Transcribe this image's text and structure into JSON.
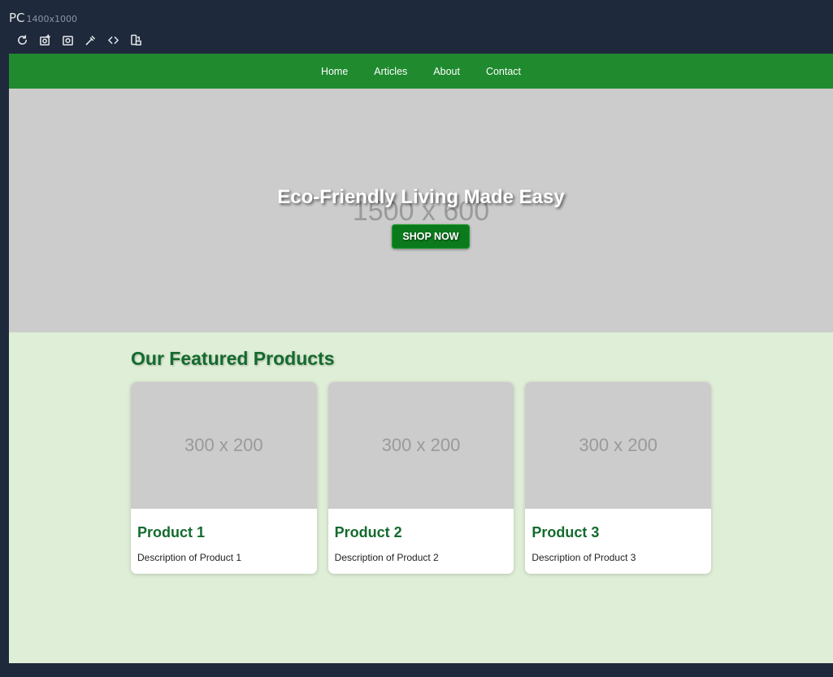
{
  "device": {
    "name": "PC",
    "resolution": "1400x1000"
  },
  "toolbar": {
    "icons": [
      "refresh-icon",
      "screenshot-full-icon",
      "camera-icon",
      "eyedropper-icon",
      "code-icon",
      "rotate-device-icon"
    ]
  },
  "site": {
    "nav": [
      {
        "label": "Home"
      },
      {
        "label": "Articles"
      },
      {
        "label": "About"
      },
      {
        "label": "Contact"
      }
    ],
    "hero": {
      "placeholder": "1500 x 600",
      "title": "Eco-Friendly Living Made Easy",
      "button": "SHOP NOW"
    },
    "featured": {
      "title": "Our Featured Products",
      "products": [
        {
          "image": "300 x 200",
          "name": "Product 1",
          "description": "Description of Product 1"
        },
        {
          "image": "300 x 200",
          "name": "Product 2",
          "description": "Description of Product 2"
        },
        {
          "image": "300 x 200",
          "name": "Product 3",
          "description": "Description of Product 3"
        }
      ]
    }
  },
  "colors": {
    "app_background": "#1e293b",
    "nav_green": "#1f8a2e",
    "heading_green": "#146b2e",
    "page_background": "#dfeed6",
    "placeholder_gray": "#cccccc"
  }
}
